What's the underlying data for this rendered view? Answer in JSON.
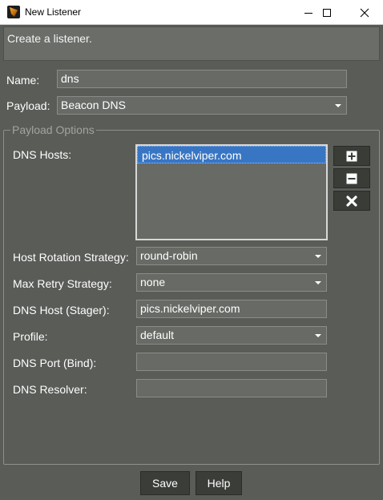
{
  "window": {
    "title": "New Listener",
    "minimize_icon": "minimize-icon",
    "maximize_icon": "maximize-icon",
    "close_icon": "close-icon"
  },
  "banner": {
    "text": "Create a listener."
  },
  "form": {
    "name_label": "Name:",
    "name_value": "dns",
    "payload_label": "Payload:",
    "payload_value": "Beacon DNS"
  },
  "payload_options": {
    "title": "Payload Options",
    "dns_hosts_label": "DNS Hosts:",
    "dns_hosts": [
      "pics.nickelviper.com"
    ],
    "add_icon": "plus-icon",
    "remove_icon": "minus-icon",
    "clear_icon": "x-icon",
    "host_rotation_label": "Host Rotation Strategy:",
    "host_rotation_value": "round-robin",
    "max_retry_label": "Max Retry Strategy:",
    "max_retry_value": "none",
    "dns_host_stager_label": "DNS Host (Stager):",
    "dns_host_stager_value": "pics.nickelviper.com",
    "profile_label": "Profile:",
    "profile_value": "default",
    "dns_port_bind_label": "DNS Port (Bind):",
    "dns_port_bind_value": "",
    "dns_resolver_label": "DNS Resolver:",
    "dns_resolver_value": ""
  },
  "buttons": {
    "save": "Save",
    "help": "Help"
  },
  "colors": {
    "background": "#5a5c58",
    "field": "#686a66",
    "selection": "#3876c4",
    "button": "#3b3d39"
  }
}
